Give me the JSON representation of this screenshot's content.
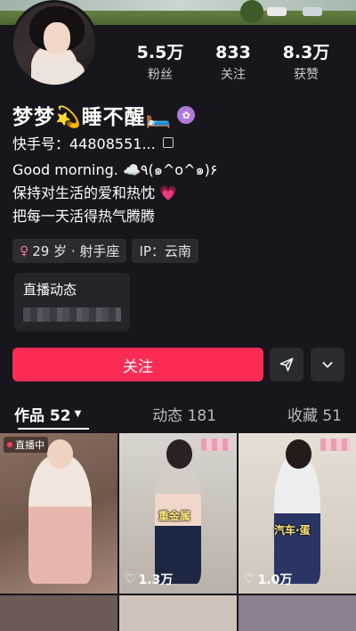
{
  "profile": {
    "name": "梦梦💫睡不醒🛏️",
    "kuaishou_id": "快手号：44808551...",
    "bio_lines": [
      "Good morning. ☁️٩(๑^o^๑)۶",
      "保持对生活的爱和热忱 💗",
      "把每一天活得热气腾腾"
    ],
    "tags": [
      {
        "label": "29 岁 · 射手座",
        "icon": "female-icon"
      },
      {
        "label": "IP：云南"
      }
    ]
  },
  "stats": [
    {
      "value": "5.5万",
      "label": "粉丝"
    },
    {
      "value": "833",
      "label": "关注"
    },
    {
      "value": "8.3万",
      "label": "获赞"
    }
  ],
  "live_card": {
    "title": "直播动态"
  },
  "actions": {
    "follow_label": "关注",
    "share_icon": "share-icon",
    "more_icon": "chevron-down-icon"
  },
  "tabs": [
    {
      "label": "作品 52",
      "active": true
    },
    {
      "label": "动态 181"
    },
    {
      "label": "收藏 51"
    }
  ],
  "grid": [
    {
      "live_label": "直播中",
      "likes": "",
      "colors": [
        "#d8b9ad",
        "#f1e6de"
      ]
    },
    {
      "caption": "重金属",
      "likes": "1.3万",
      "colors": [
        "#c9c5c0",
        "#1c2744"
      ]
    },
    {
      "caption": "汽车·蛋",
      "likes": "1.0万",
      "colors": [
        "#d7d0c6",
        "#2a3566"
      ]
    }
  ]
}
